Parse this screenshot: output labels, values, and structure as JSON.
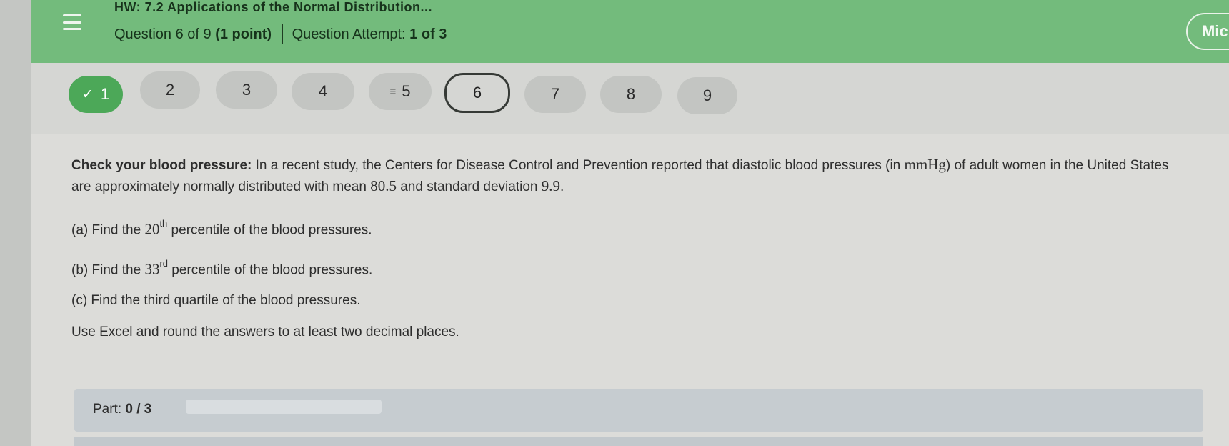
{
  "header": {
    "hw_title": "HW: 7.2 Applications of the Normal Distribution...",
    "question_label": "Question 6 of 9",
    "points": "(1 point)",
    "attempt_label": "Question Attempt:",
    "attempt_value": "1 of 3",
    "mic_label": "Mic"
  },
  "nav": {
    "items": [
      {
        "label": "1",
        "state": "completed"
      },
      {
        "label": "2",
        "state": "default"
      },
      {
        "label": "3",
        "state": "default"
      },
      {
        "label": "4",
        "state": "default"
      },
      {
        "label": "5",
        "state": "flagged"
      },
      {
        "label": "6",
        "state": "current"
      },
      {
        "label": "7",
        "state": "default"
      },
      {
        "label": "8",
        "state": "default"
      },
      {
        "label": "9",
        "state": "default"
      }
    ],
    "check_glyph": "✓",
    "flag_glyph": "≡"
  },
  "problem": {
    "lead_bold": "Check your blood pressure:",
    "lead_text_1": " In a recent study, the Centers for Disease Control and Prevention reported that diastolic blood pressures (in ",
    "unit": "mmHg",
    "lead_text_2": ") of adult women in the United States are approximately normally distributed with mean ",
    "mean": "80.5",
    "lead_text_3": " and standard deviation ",
    "sd": "9.9",
    "lead_text_4": ".",
    "a_prefix": "(a) Find the ",
    "a_num": "20",
    "a_sup": "th",
    "a_suffix": " percentile of the blood pressures.",
    "b_prefix": "(b) Find the ",
    "b_num": "33",
    "b_sup": "rd",
    "b_suffix": " percentile of the blood pressures.",
    "c_text": "(c) Find the third quartile of the blood pressures.",
    "instructions": "Use Excel and round the answers to at least two decimal places."
  },
  "part": {
    "label": "Part:",
    "value": "0 / 3",
    "progress_fraction": 0
  },
  "colors": {
    "header_green": "#73bb7c",
    "completed_green": "#4ca858"
  }
}
